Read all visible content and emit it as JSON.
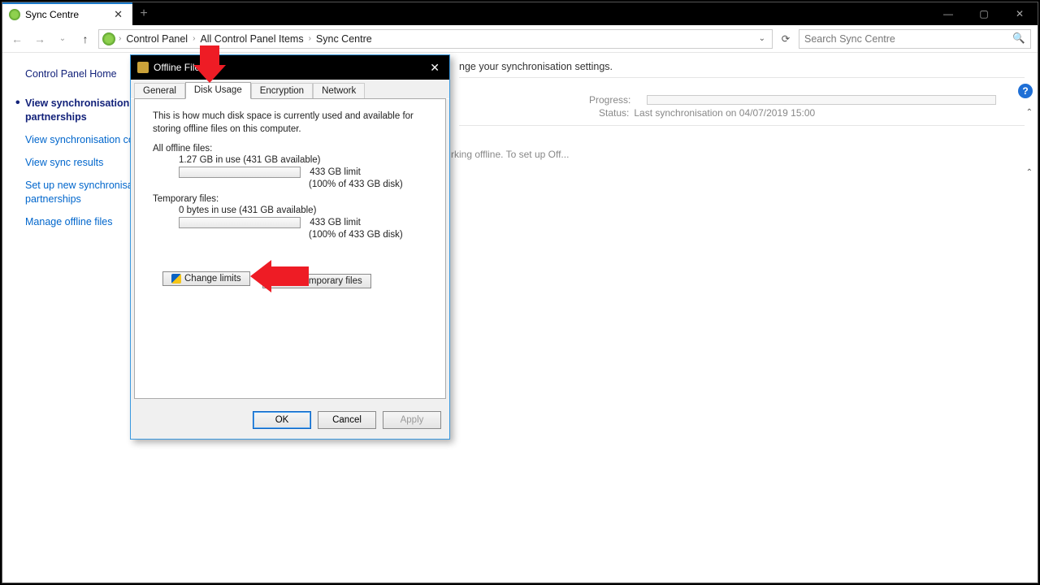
{
  "tab_title": "Sync Centre",
  "breadcrumbs": [
    "Control Panel",
    "All Control Panel Items",
    "Sync Centre"
  ],
  "search_placeholder": "Search Sync Centre",
  "sidebar": {
    "home": "Control Panel Home",
    "links": [
      "View synchronisation partnerships",
      "View synchronisation conflicts",
      "View sync results",
      "Set up new synchronisation partnerships",
      "Manage offline files"
    ]
  },
  "main": {
    "desc_fragment": "nge your synchronisation settings.",
    "offline_fragment": "rking offline. To set up Off...",
    "progress_label": "Progress:",
    "status_label": "Status:",
    "status_value": "Last synchronisation on 04/07/2019 15:00"
  },
  "dialog": {
    "title": "Offline Files",
    "tabs": [
      "General",
      "Disk Usage",
      "Encryption",
      "Network"
    ],
    "active_tab": "Disk Usage",
    "description": "This is how much disk space is currently used and available for storing offline files on this computer.",
    "all_offline_label": "All offline files:",
    "all_offline_usage": "1.27 GB in use (431 GB available)",
    "all_offline_limit": "433 GB limit",
    "all_offline_pct": "(100% of 433 GB disk)",
    "temp_label": "Temporary files:",
    "temp_usage": "0 bytes in use (431 GB available)",
    "temp_limit": "433 GB limit",
    "temp_pct": "(100% of 433 GB disk)",
    "change_limits": "Change limits",
    "delete_temp": "Delete temporary files",
    "ok": "OK",
    "cancel": "Cancel",
    "apply": "Apply"
  }
}
